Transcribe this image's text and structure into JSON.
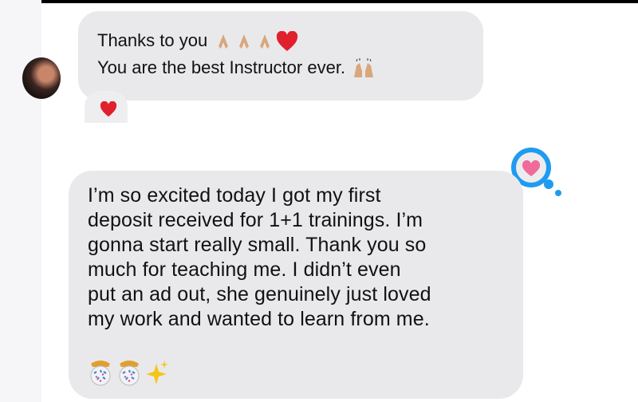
{
  "conversation": {
    "message_1": {
      "lines": [
        "Thanks to you",
        "You are the best Instructor ever."
      ],
      "emoji_line_1": [
        "folded-hands",
        "folded-hands",
        "folded-hands",
        "red-heart"
      ],
      "emoji_line_2": [
        "raising-hands"
      ],
      "reaction": "red-heart"
    },
    "message_2": {
      "lines": [
        "I’m so excited today I got my first",
        "deposit received for 1+1 trainings. I’m",
        "gonna start really small. Thank you so",
        "much for teaching me. I didn’t even",
        "put an ad out, she genuinely just loved",
        "my work and wanted to learn from me."
      ],
      "trailing_emoji": [
        "confetti-ball",
        "confetti-ball",
        "sparkles"
      ],
      "reaction": "heart-speech-bubble"
    },
    "colors": {
      "bubble": "#e9e9ec",
      "reaction_blue": "#1f9bf0",
      "heart_red": "#e0202c",
      "heart_pink": "#f06a9a"
    }
  }
}
